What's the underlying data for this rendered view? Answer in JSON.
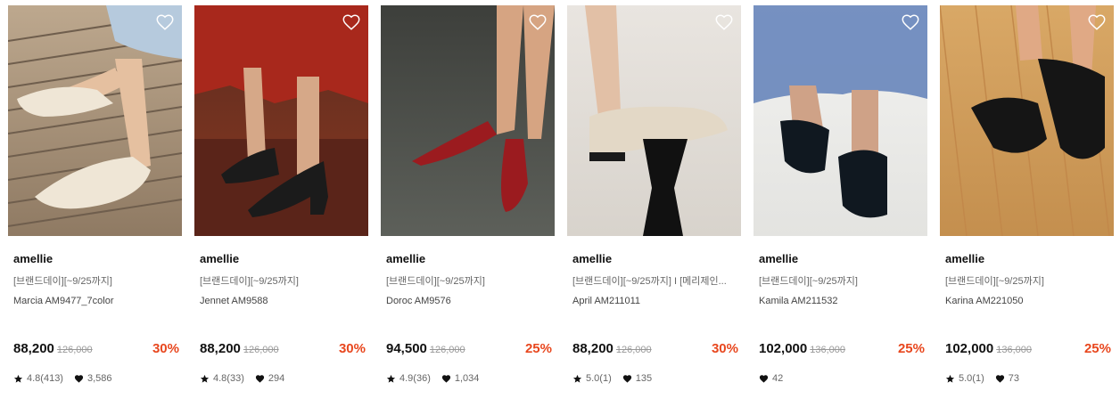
{
  "products": [
    {
      "brand": "amellie",
      "promo": "[브랜드데이][~9/25까지]",
      "name": "Marcia AM9477_7color",
      "price": "88,200",
      "original_price": "126,000",
      "discount": "30%",
      "rating": "4.8(413)",
      "likes": "3,586",
      "image_desc": "cream slingback on wooden deck",
      "palette": {
        "bg1": "#bda88e",
        "bg2": "#8f7a63",
        "shoe": "#efe6d6",
        "skin": "#e5c0a0",
        "accent": "#b6cadd"
      }
    },
    {
      "brand": "amellie",
      "promo": "[브랜드데이][~9/25까지]",
      "name": "Jennet AM9588",
      "price": "88,200",
      "original_price": "126,000",
      "discount": "30%",
      "rating": "4.8(33)",
      "likes": "294",
      "image_desc": "black mary jane heels, red skirt",
      "palette": {
        "bg1": "#5b2a1e",
        "bg2": "#8a3a22",
        "shoe": "#1b1b1b",
        "skin": "#d6a888",
        "accent": "#a8281c"
      }
    },
    {
      "brand": "amellie",
      "promo": "[브랜드데이][~9/25까지]",
      "name": "Doroc AM9576",
      "price": "94,500",
      "original_price": "126,000",
      "discount": "25%",
      "rating": "4.9(36)",
      "likes": "1,034",
      "image_desc": "red pointed flats on dark carpet",
      "palette": {
        "bg1": "#3d3f3b",
        "bg2": "#5d605a",
        "shoe": "#9b1b1f",
        "skin": "#d6a482",
        "accent": "#2e302c"
      }
    },
    {
      "brand": "amellie",
      "promo": "[브랜드데이][~9/25까지] I [메리제인...",
      "name": "April AM211011",
      "price": "88,200",
      "original_price": "126,000",
      "discount": "30%",
      "rating": "5.0(1)",
      "likes": "135",
      "image_desc": "beige mary jane flat on black stand",
      "palette": {
        "bg1": "#e9e5e0",
        "bg2": "#d8d3cc",
        "shoe": "#e3d8c6",
        "skin": "#e2c0a6",
        "accent": "#111111"
      }
    },
    {
      "brand": "amellie",
      "promo": "[브랜드데이][~9/25까지]",
      "name": "Kamila AM211532",
      "price": "102,000",
      "original_price": "136,000",
      "discount": "25%",
      "rating": "",
      "likes": "42",
      "image_desc": "black square toe pumps, blue skirt",
      "palette": {
        "bg1": "#f3f3f1",
        "bg2": "#e3e3e0",
        "shoe": "#101820",
        "skin": "#cfa287",
        "accent": "#5f7fb8"
      }
    },
    {
      "brand": "amellie",
      "promo": "[브랜드데이][~9/25까지]",
      "name": "Karina AM221050",
      "price": "102,000",
      "original_price": "136,000",
      "discount": "25%",
      "rating": "5.0(1)",
      "likes": "73",
      "image_desc": "black mary jane flats on wooden floor",
      "palette": {
        "bg1": "#d9a866",
        "bg2": "#c48f4e",
        "shoe": "#151515",
        "skin": "#e0a985",
        "accent": "#f0d3a5"
      }
    }
  ],
  "icons": {
    "wishlist": "heart-outline-icon",
    "rating": "star-icon",
    "likes": "heart-filled-icon"
  },
  "colors": {
    "discount": "#e8471e"
  }
}
